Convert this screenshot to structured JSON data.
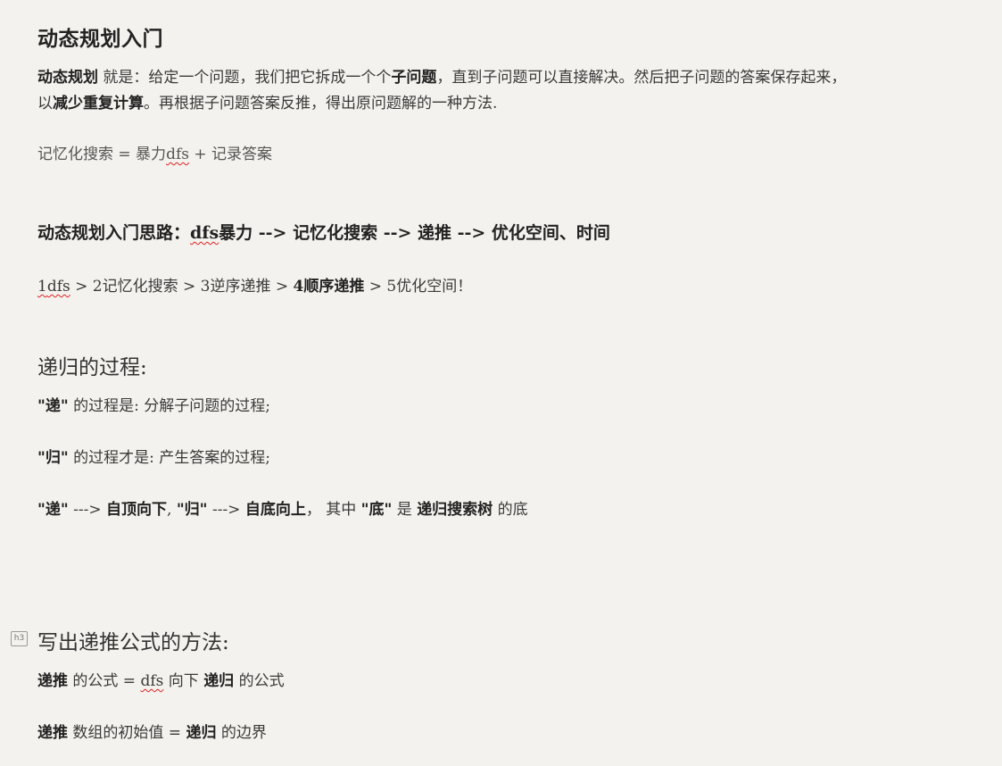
{
  "title": "动态规划入门",
  "intro": {
    "line1_pre_bold": "动态规划",
    "line1_a": " 就是：给定一个问题，我们把它拆成一个个",
    "line1_bold": "子问题",
    "line1_b": "，直到子问题可以直接解决。然后把子问题的答案保存起来，",
    "line2_pre": "以",
    "line2_bold": "减少重复计算",
    "line2_post": "。再根据子问题答案反推，得出原问题解的一种方法."
  },
  "memo": {
    "pre": "记忆化搜索 = 暴力",
    "dfs": "dfs",
    "post": " + 记录答案"
  },
  "roadmap": {
    "pre": "动态规划入门思路：",
    "dfs": "dfs",
    "post": "暴力 --> 记忆化搜索  --> 递推 --> 优化空间、时间"
  },
  "steps": {
    "num1": "1",
    "dfs": "dfs",
    "mid": " > 2记忆化搜索 > 3逆序递推 > ",
    "bold": "4顺序递推",
    "post": " > 5优化空间！"
  },
  "recursion": {
    "heading": "递归的过程:",
    "l1_bold": "\"递\"",
    "l1_rest": " 的过程是: 分解子问题的过程;",
    "l2_bold": "\"归\"",
    "l2_rest": " 的过程才是: 产生答案的过程;",
    "l3_b1": "\"递\"",
    "l3_t1": "  ---> ",
    "l3_b2": "自顶向下",
    "l3_t2": ", ",
    "l3_b3": "\"归\"",
    "l3_t3": " ---> ",
    "l3_b4": "自底向上",
    "l3_t4": "，  其中 ",
    "l3_b5": "\"底\"",
    "l3_t5": " 是 ",
    "l3_b6": "递归搜索树",
    "l3_t6": " 的底"
  },
  "formula": {
    "badge": "h3",
    "heading": "写出递推公式的方法:",
    "l1_b1": "递推",
    "l1_t1": " 的公式  = ",
    "l1_dfs": "dfs",
    "l1_t2": " 向下 ",
    "l1_b2": "递归",
    "l1_t3": " 的公式",
    "l2_b1": "递推",
    "l2_t1": " 数组的初始值 = ",
    "l2_b2": "递归",
    "l2_t2": " 的边界"
  }
}
